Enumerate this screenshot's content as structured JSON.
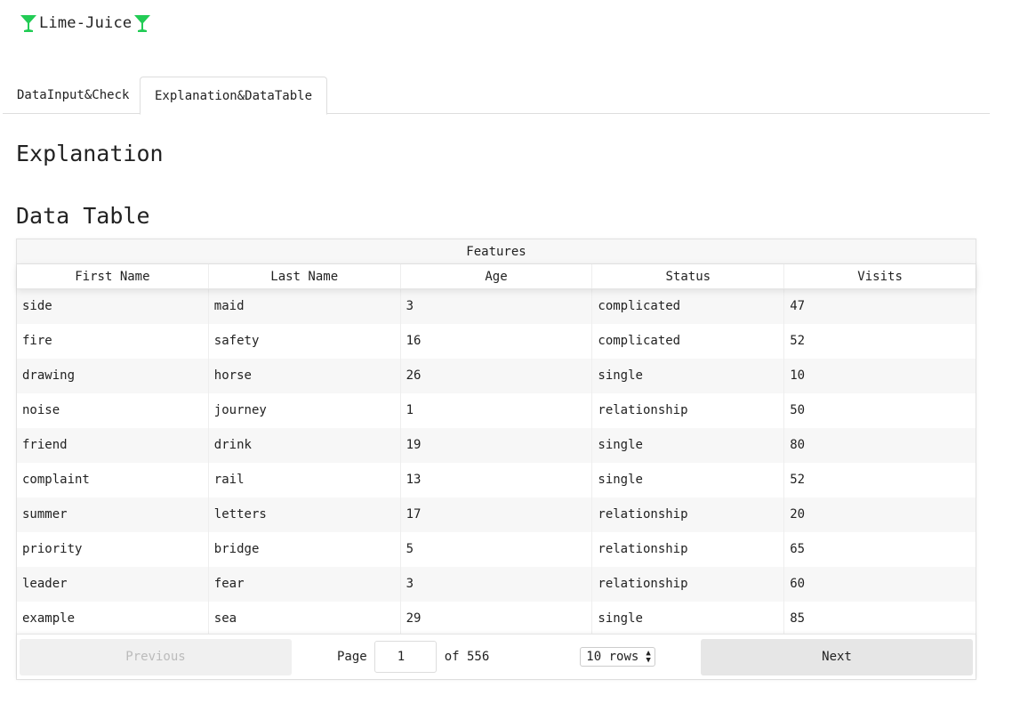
{
  "brand": {
    "title": "Lime-Juice",
    "icon": "cocktail-glass-icon",
    "icon_color": "#22cc55"
  },
  "tabs": [
    {
      "label": "DataInput&Check",
      "active": false
    },
    {
      "label": "Explanation&DataTable",
      "active": true
    }
  ],
  "sections": {
    "explanation": "Explanation",
    "data_table": "Data Table"
  },
  "table": {
    "group_header": "Features",
    "columns": [
      "First Name",
      "Last Name",
      "Age",
      "Status",
      "Visits"
    ],
    "rows": [
      [
        "side",
        "maid",
        "3",
        "complicated",
        "47"
      ],
      [
        "fire",
        "safety",
        "16",
        "complicated",
        "52"
      ],
      [
        "drawing",
        "horse",
        "26",
        "single",
        "10"
      ],
      [
        "noise",
        "journey",
        "1",
        "relationship",
        "50"
      ],
      [
        "friend",
        "drink",
        "19",
        "single",
        "80"
      ],
      [
        "complaint",
        "rail",
        "13",
        "single",
        "52"
      ],
      [
        "summer",
        "letters",
        "17",
        "relationship",
        "20"
      ],
      [
        "priority",
        "bridge",
        "5",
        "relationship",
        "65"
      ],
      [
        "leader",
        "fear",
        "3",
        "relationship",
        "60"
      ],
      [
        "example",
        "sea",
        "29",
        "single",
        "85"
      ]
    ]
  },
  "pagination": {
    "previous_label": "Previous",
    "next_label": "Next",
    "page_label": "Page",
    "page_value": "1",
    "of_label": "of 556",
    "rows_label": "10 rows"
  }
}
